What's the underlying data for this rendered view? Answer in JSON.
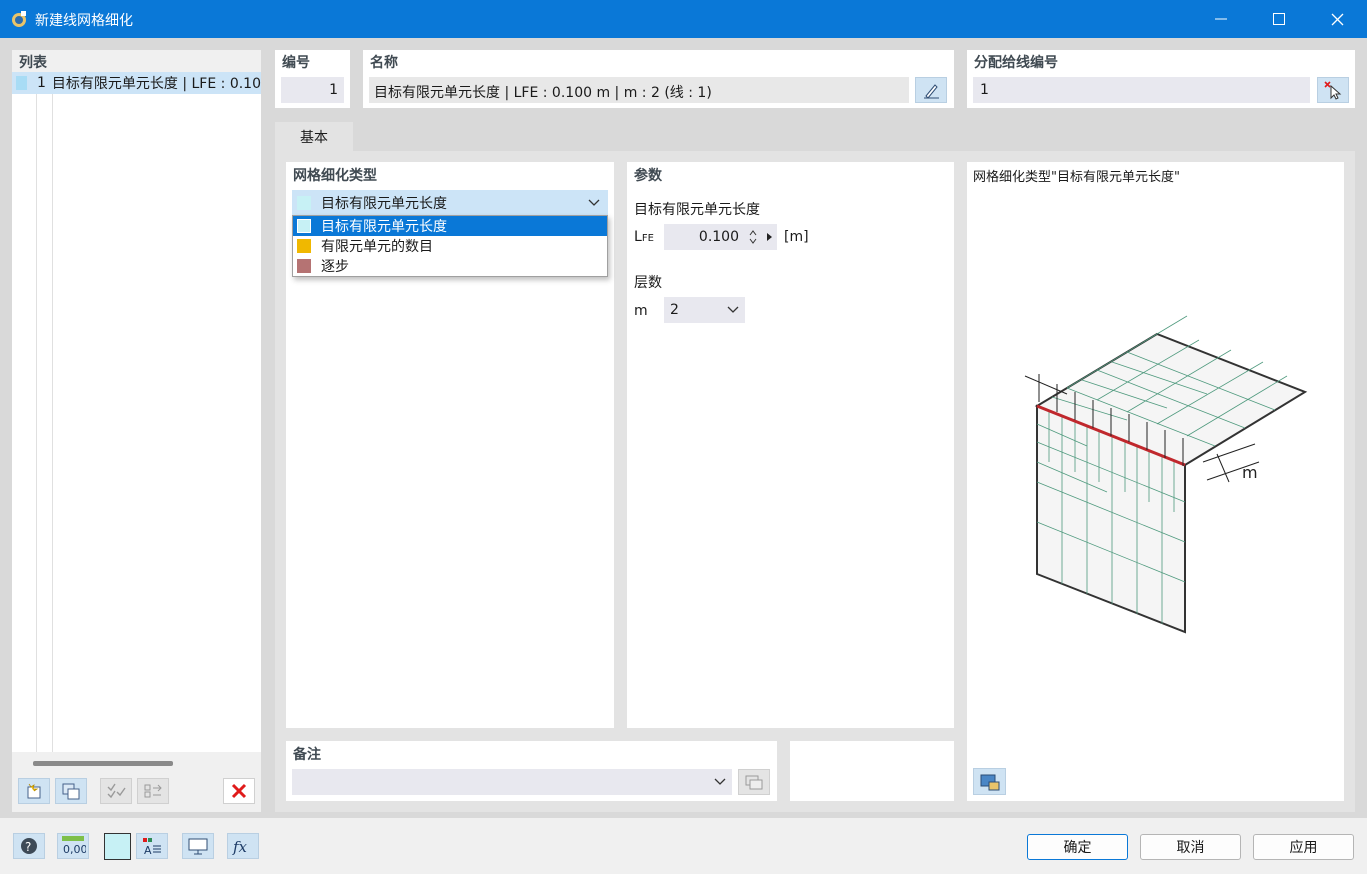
{
  "window": {
    "title": "新建线网格细化"
  },
  "list": {
    "header": "列表",
    "items": [
      {
        "number": "1",
        "label": "目标有限元单元长度 | LFE : 0.10",
        "color": "#a8dcf5"
      }
    ]
  },
  "fields": {
    "number_label": "编号",
    "number_value": "1",
    "name_label": "名称",
    "name_value": "目标有限元单元长度 | LFE : 0.100 m | m : 2 (线 : 1)",
    "assign_label": "分配给线编号",
    "assign_value": "1"
  },
  "tabs": [
    {
      "label": "基本",
      "active": true
    }
  ],
  "refinement": {
    "header": "网格细化类型",
    "selected": "目标有限元单元长度",
    "options": [
      {
        "label": "目标有限元单元长度",
        "color": "#c7f1f5",
        "highlighted": true
      },
      {
        "label": "有限元单元的数目",
        "color": "#f0b800",
        "highlighted": false
      },
      {
        "label": "逐步",
        "color": "#b57373",
        "highlighted": false
      }
    ]
  },
  "params": {
    "header": "参数",
    "target_length_label": "目标有限元单元长度",
    "lfe_symbol_main": "L",
    "lfe_symbol_sub": "FE",
    "lfe_value": "0.100",
    "lfe_unit": "[m]",
    "layers_label": "层数",
    "m_symbol": "m",
    "m_value": "2"
  },
  "preview": {
    "caption": "网格细化类型\"目标有限元单元长度\"",
    "dim_label": "m"
  },
  "notes": {
    "label": "备注",
    "value": ""
  },
  "footer": {
    "ok": "确定",
    "cancel": "取消",
    "apply": "应用"
  },
  "colors": {
    "accent": "#0a78d7",
    "edge_highlight": "#c0282d",
    "mesh": "#4f9a7e"
  }
}
